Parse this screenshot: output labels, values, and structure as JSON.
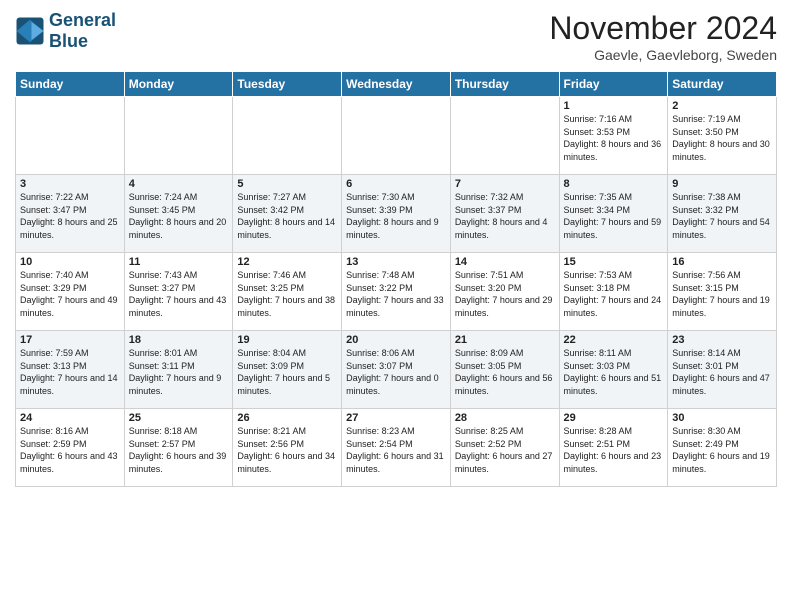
{
  "header": {
    "logo_line1": "General",
    "logo_line2": "Blue",
    "month": "November 2024",
    "location": "Gaevle, Gaevleborg, Sweden"
  },
  "weekdays": [
    "Sunday",
    "Monday",
    "Tuesday",
    "Wednesday",
    "Thursday",
    "Friday",
    "Saturday"
  ],
  "weeks": [
    [
      {
        "day": "",
        "info": ""
      },
      {
        "day": "",
        "info": ""
      },
      {
        "day": "",
        "info": ""
      },
      {
        "day": "",
        "info": ""
      },
      {
        "day": "",
        "info": ""
      },
      {
        "day": "1",
        "info": "Sunrise: 7:16 AM\nSunset: 3:53 PM\nDaylight: 8 hours and 36 minutes."
      },
      {
        "day": "2",
        "info": "Sunrise: 7:19 AM\nSunset: 3:50 PM\nDaylight: 8 hours and 30 minutes."
      }
    ],
    [
      {
        "day": "3",
        "info": "Sunrise: 7:22 AM\nSunset: 3:47 PM\nDaylight: 8 hours and 25 minutes."
      },
      {
        "day": "4",
        "info": "Sunrise: 7:24 AM\nSunset: 3:45 PM\nDaylight: 8 hours and 20 minutes."
      },
      {
        "day": "5",
        "info": "Sunrise: 7:27 AM\nSunset: 3:42 PM\nDaylight: 8 hours and 14 minutes."
      },
      {
        "day": "6",
        "info": "Sunrise: 7:30 AM\nSunset: 3:39 PM\nDaylight: 8 hours and 9 minutes."
      },
      {
        "day": "7",
        "info": "Sunrise: 7:32 AM\nSunset: 3:37 PM\nDaylight: 8 hours and 4 minutes."
      },
      {
        "day": "8",
        "info": "Sunrise: 7:35 AM\nSunset: 3:34 PM\nDaylight: 7 hours and 59 minutes."
      },
      {
        "day": "9",
        "info": "Sunrise: 7:38 AM\nSunset: 3:32 PM\nDaylight: 7 hours and 54 minutes."
      }
    ],
    [
      {
        "day": "10",
        "info": "Sunrise: 7:40 AM\nSunset: 3:29 PM\nDaylight: 7 hours and 49 minutes."
      },
      {
        "day": "11",
        "info": "Sunrise: 7:43 AM\nSunset: 3:27 PM\nDaylight: 7 hours and 43 minutes."
      },
      {
        "day": "12",
        "info": "Sunrise: 7:46 AM\nSunset: 3:25 PM\nDaylight: 7 hours and 38 minutes."
      },
      {
        "day": "13",
        "info": "Sunrise: 7:48 AM\nSunset: 3:22 PM\nDaylight: 7 hours and 33 minutes."
      },
      {
        "day": "14",
        "info": "Sunrise: 7:51 AM\nSunset: 3:20 PM\nDaylight: 7 hours and 29 minutes."
      },
      {
        "day": "15",
        "info": "Sunrise: 7:53 AM\nSunset: 3:18 PM\nDaylight: 7 hours and 24 minutes."
      },
      {
        "day": "16",
        "info": "Sunrise: 7:56 AM\nSunset: 3:15 PM\nDaylight: 7 hours and 19 minutes."
      }
    ],
    [
      {
        "day": "17",
        "info": "Sunrise: 7:59 AM\nSunset: 3:13 PM\nDaylight: 7 hours and 14 minutes."
      },
      {
        "day": "18",
        "info": "Sunrise: 8:01 AM\nSunset: 3:11 PM\nDaylight: 7 hours and 9 minutes."
      },
      {
        "day": "19",
        "info": "Sunrise: 8:04 AM\nSunset: 3:09 PM\nDaylight: 7 hours and 5 minutes."
      },
      {
        "day": "20",
        "info": "Sunrise: 8:06 AM\nSunset: 3:07 PM\nDaylight: 7 hours and 0 minutes."
      },
      {
        "day": "21",
        "info": "Sunrise: 8:09 AM\nSunset: 3:05 PM\nDaylight: 6 hours and 56 minutes."
      },
      {
        "day": "22",
        "info": "Sunrise: 8:11 AM\nSunset: 3:03 PM\nDaylight: 6 hours and 51 minutes."
      },
      {
        "day": "23",
        "info": "Sunrise: 8:14 AM\nSunset: 3:01 PM\nDaylight: 6 hours and 47 minutes."
      }
    ],
    [
      {
        "day": "24",
        "info": "Sunrise: 8:16 AM\nSunset: 2:59 PM\nDaylight: 6 hours and 43 minutes."
      },
      {
        "day": "25",
        "info": "Sunrise: 8:18 AM\nSunset: 2:57 PM\nDaylight: 6 hours and 39 minutes."
      },
      {
        "day": "26",
        "info": "Sunrise: 8:21 AM\nSunset: 2:56 PM\nDaylight: 6 hours and 34 minutes."
      },
      {
        "day": "27",
        "info": "Sunrise: 8:23 AM\nSunset: 2:54 PM\nDaylight: 6 hours and 31 minutes."
      },
      {
        "day": "28",
        "info": "Sunrise: 8:25 AM\nSunset: 2:52 PM\nDaylight: 6 hours and 27 minutes."
      },
      {
        "day": "29",
        "info": "Sunrise: 8:28 AM\nSunset: 2:51 PM\nDaylight: 6 hours and 23 minutes."
      },
      {
        "day": "30",
        "info": "Sunrise: 8:30 AM\nSunset: 2:49 PM\nDaylight: 6 hours and 19 minutes."
      }
    ]
  ]
}
